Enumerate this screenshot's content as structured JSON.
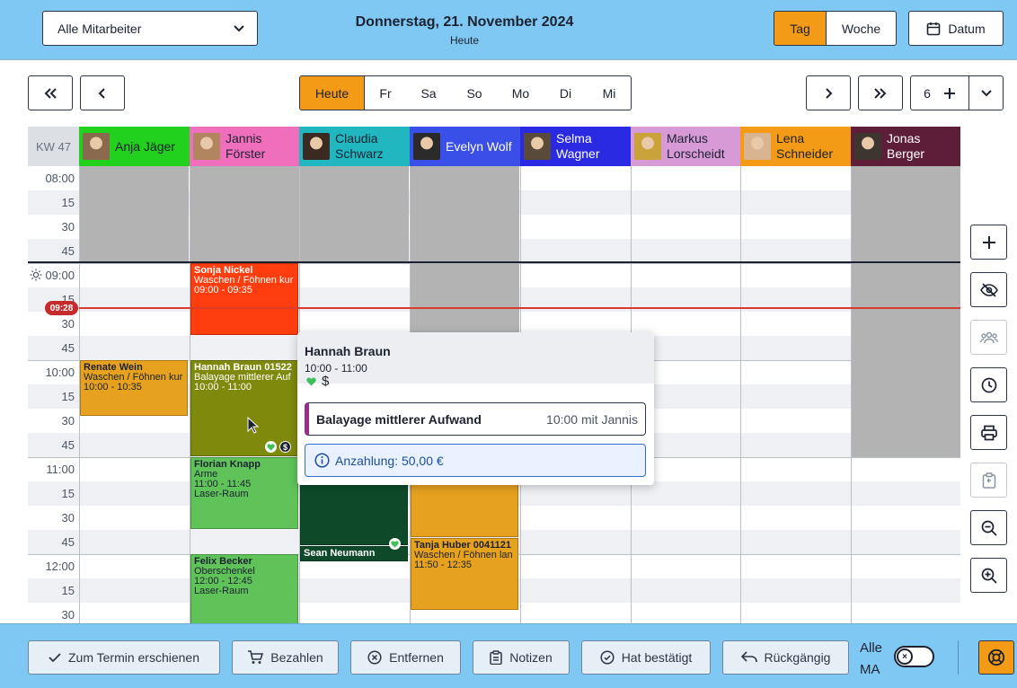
{
  "header": {
    "employee_select": "Alle Mitarbeiter",
    "date_title": "Donnerstag, 21. November 2024",
    "date_subtitle": "Heute",
    "view_day": "Tag",
    "view_week": "Woche",
    "date_button": "Datum"
  },
  "nav": {
    "today": "Heute",
    "days": [
      "Fr",
      "Sa",
      "So",
      "Mo",
      "Di",
      "Mi"
    ],
    "column_count": "6"
  },
  "grid": {
    "week_label": "KW 47",
    "employees": [
      {
        "name_line1": "Anja Jäger",
        "name_line2": "",
        "color": "#22d11e"
      },
      {
        "name_line1": "Jannis",
        "name_line2": "Förster",
        "color": "#f06fbd"
      },
      {
        "name_line1": "Claudia",
        "name_line2": "Schwarz",
        "color": "#20b7c0"
      },
      {
        "name_line1": "Evelyn Wolf",
        "name_line2": "",
        "color": "#3a4fe8"
      },
      {
        "name_line1": "Selma",
        "name_line2": "Wagner",
        "color": "#2b2ae3"
      },
      {
        "name_line1": "Markus",
        "name_line2": "Lorscheidt",
        "color": "#d79ad6"
      },
      {
        "name_line1": "Lena",
        "name_line2": "Schneider",
        "color": "#f39a16"
      },
      {
        "name_line1": "Jonas",
        "name_line2": "Berger",
        "color": "#5e1e3a"
      }
    ],
    "times": [
      "08:00",
      "15",
      "30",
      "45",
      "09:00",
      "15",
      "30",
      "45",
      "10:00",
      "15",
      "30",
      "45",
      "11:00",
      "15",
      "30",
      "45",
      "12:00",
      "15",
      "30"
    ],
    "current_time": "09:28"
  },
  "appointments": [
    {
      "col": 1,
      "start": "09:00",
      "end": "09:45",
      "title": "Sonja Nickel",
      "line2": "Waschen / Föhnen kur",
      "line3": "09:00 - 09:35",
      "line4": "",
      "color": "#ff3d0f",
      "text_color": "#ffffff"
    },
    {
      "col": 0,
      "start": "10:00",
      "end": "10:35",
      "title": "Renate Wein",
      "line2": "Waschen / Föhnen kur",
      "line3": "10:00 - 10:35",
      "line4": "",
      "color": "#e6a11f",
      "text_color": "#1c2230"
    },
    {
      "col": 1,
      "start": "10:00",
      "end": "11:00",
      "title": "Hannah Braun  01522",
      "line2": "Balayage mittlerer Auf",
      "line3": "10:00 - 11:00",
      "line4": "",
      "color": "#7f8a0c",
      "text_color": "#ffffff"
    },
    {
      "col": 1,
      "start": "11:00",
      "end": "11:45",
      "title": "Florian Knapp",
      "line2": "Arme",
      "line3": "11:00 - 11:45",
      "line4": "Laser-Raum",
      "color": "#5fc35a",
      "text_color": "#1c2230"
    },
    {
      "col": 1,
      "start": "12:00",
      "end": "12:45",
      "title": "Felix Becker",
      "line2": "Oberschenkel",
      "line3": "12:00 - 12:45",
      "line4": "Laser-Raum",
      "color": "#5fc35a",
      "text_color": "#1c2230"
    },
    {
      "col": 2,
      "start": "11:05",
      "end": "11:55",
      "title": "",
      "line2": "",
      "line3": "",
      "line4": "",
      "color": "#0e4a2a",
      "text_color": "#ffffff"
    },
    {
      "col": 2,
      "start": "11:55",
      "end": "12:05",
      "title": "Sean Neumann",
      "line2": "",
      "line3": "",
      "line4": "",
      "color": "#0e4a2a",
      "text_color": "#ffffff"
    },
    {
      "col": 3,
      "start": "11:05",
      "end": "11:50",
      "title": "",
      "line2": "",
      "line3": "",
      "line4": "",
      "color": "#e6a11f",
      "text_color": "#1c2230"
    },
    {
      "col": 3,
      "start": "11:50",
      "end": "12:35",
      "title": "Tanja Huber  0041121",
      "line2": "Waschen / Föhnen lan",
      "line3": "11:50 - 12:35",
      "line4": "",
      "color": "#e6a11f",
      "text_color": "#1c2230"
    }
  ],
  "popover": {
    "name": "Hannah Braun",
    "time": "10:00 - 11:00",
    "status_icon": "heart-icon",
    "dollar": "$",
    "service_name": "Balayage mittlerer Aufwand",
    "service_meta": "10:00 mit Jannis",
    "deposit": "Anzahlung: 50,00 €"
  },
  "sidebar_buttons": [
    "plus-icon",
    "eye-off-icon",
    "team-icon",
    "clock-icon",
    "print-icon",
    "clipboard-icon",
    "zoom-out-icon",
    "zoom-in-icon"
  ],
  "bottombar": {
    "appeared": "Zum Termin erschienen",
    "pay": "Bezahlen",
    "remove": "Entfernen",
    "notes": "Notizen",
    "confirmed": "Hat bestätigt",
    "undo": "Rückgängig",
    "all_ma_line1": "Alle",
    "all_ma_line2": "MA",
    "toggle_glyph": "×"
  },
  "colors": {
    "accent": "#f39a16",
    "header_bg": "#7ec8f3",
    "now_line": "#d83c2c"
  }
}
